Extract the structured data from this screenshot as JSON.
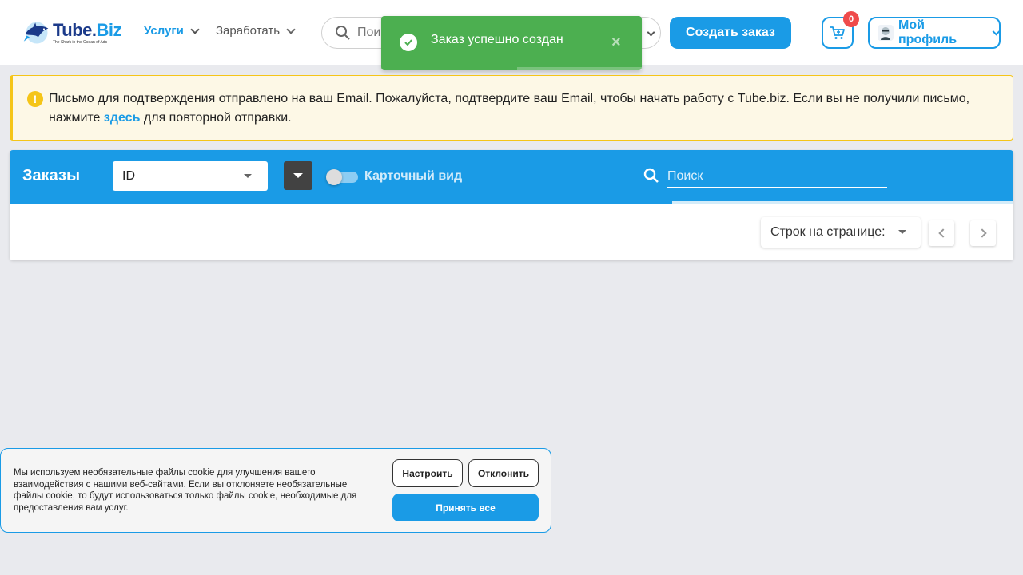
{
  "header": {
    "logo_name_part1": "Tube.",
    "logo_name_part2": "Biz",
    "logo_tagline": "The Shark in the Ocean of Ads",
    "nav": [
      {
        "label": "Услуги",
        "active": true
      },
      {
        "label": "Заработать",
        "active": false
      }
    ],
    "search_placeholder": "Поиск",
    "create_order_label": "Создать заказ",
    "cart_count": "0",
    "profile_label": "Мой профиль"
  },
  "toast": {
    "message": "Заказ успешно создан",
    "close": "×",
    "color": "#4caf50"
  },
  "alert": {
    "icon": "!",
    "text_before": "Письмо для подтверждения отправлено на ваш Email. Пожалуйста, подтвердите ваш Email, чтобы начать работу с Tube.biz. Если вы не получили письмо, нажмите ",
    "link_text": "здесь",
    "text_after": " для повторной отправки."
  },
  "orders": {
    "title": "Заказы",
    "sort_field": "ID",
    "card_view_label": "Карточный вид",
    "search_placeholder": "Поиск",
    "rows_per_page_label": "Строк на странице:"
  },
  "cookie": {
    "text": "Мы используем необязательные файлы cookie для улучшения вашего взаимодействия с нашими веб-сайтами. Если вы отклоняете необязательные файлы cookie, то будут использоваться только файлы cookie, необходимые для предоставления вам услуг.",
    "configure_label": "Настроить",
    "decline_label": "Отклонить",
    "accept_label": "Принять все"
  },
  "colors": {
    "accent": "#1a9be6",
    "warning": "#f5c518",
    "success": "#4caf50",
    "badge": "#ef4b4b"
  }
}
